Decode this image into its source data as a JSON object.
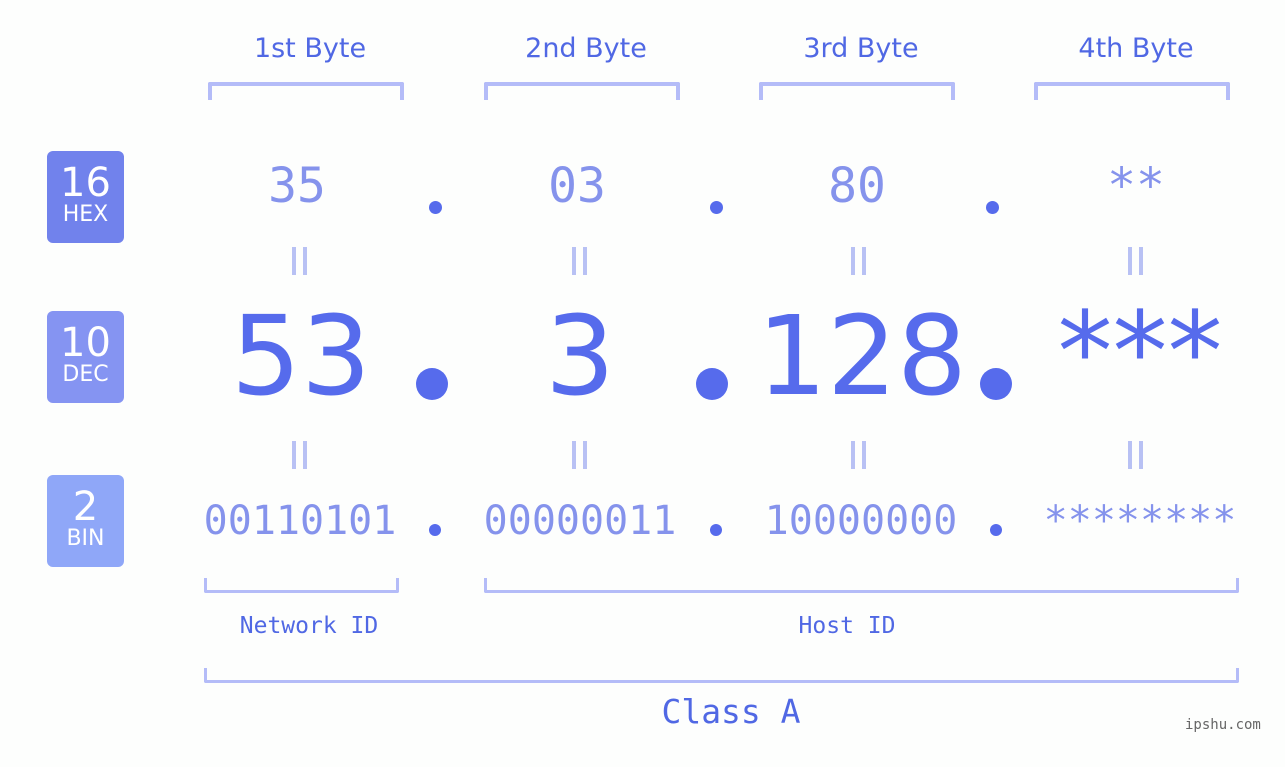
{
  "byte_headers": [
    "1st Byte",
    "2nd Byte",
    "3rd Byte",
    "4th Byte"
  ],
  "rows": {
    "hex": {
      "base": "16",
      "label": "HEX",
      "values": [
        "35",
        "03",
        "80",
        "**"
      ],
      "color": "#7182ec"
    },
    "dec": {
      "base": "10",
      "label": "DEC",
      "values": [
        "53",
        "3",
        "128",
        "***"
      ],
      "color": "#8594f2"
    },
    "bin": {
      "base": "2",
      "label": "BIN",
      "values": [
        "00110101",
        "00000011",
        "10000000",
        "********"
      ],
      "color": "#8fa7f8"
    }
  },
  "separator": ".",
  "network_id_label": "Network ID",
  "host_id_label": "Host ID",
  "class_label": "Class A",
  "watermark": "ipshu.com",
  "colors": {
    "accent": "#566bec",
    "light_value": "#8593ec",
    "bracket": "#b4bcf8",
    "label_text": "#5068e4"
  }
}
